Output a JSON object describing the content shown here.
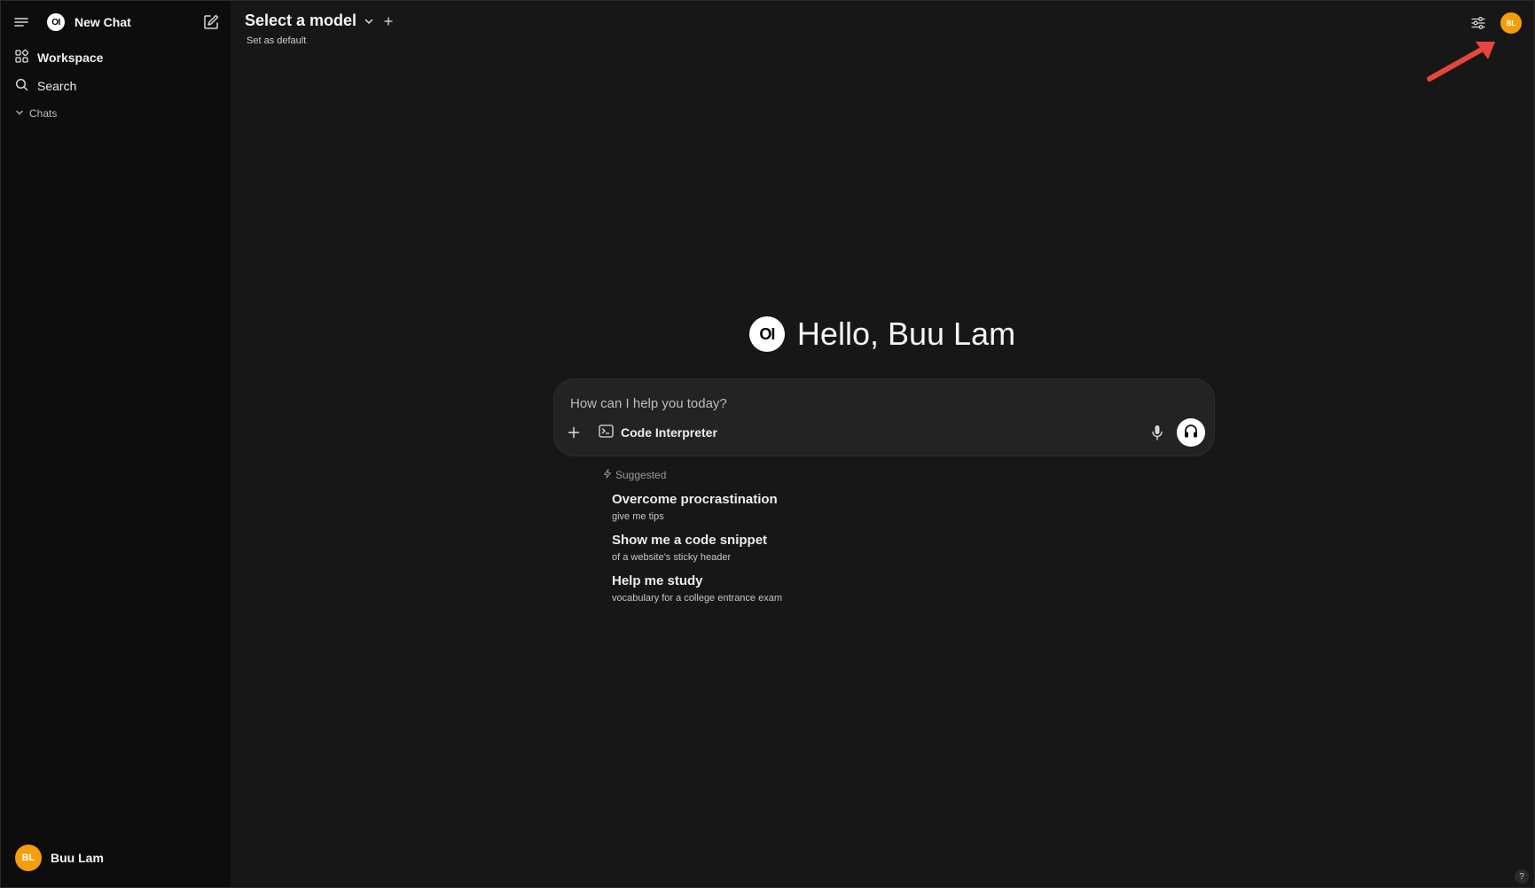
{
  "sidebar": {
    "logo_text": "OI",
    "new_chat_label": "New Chat",
    "items": [
      {
        "label": "Workspace",
        "icon": "workspace-icon"
      },
      {
        "label": "Search",
        "icon": "search-icon"
      }
    ],
    "chats_section_label": "Chats",
    "user": {
      "initials": "BL",
      "name": "Buu Lam"
    }
  },
  "header": {
    "model_title": "Select a model",
    "set_default_label": "Set as default",
    "avatar_initials": "BL"
  },
  "greeting": {
    "logo_text": "OI",
    "text": "Hello, Buu Lam"
  },
  "composer": {
    "placeholder": "How can I help you today?",
    "value": "",
    "code_interpreter_label": "Code Interpreter"
  },
  "suggested": {
    "heading": "Suggested",
    "items": [
      {
        "title": "Overcome procrastination",
        "subtitle": "give me tips"
      },
      {
        "title": "Show me a code snippet",
        "subtitle": "of a website's sticky header"
      },
      {
        "title": "Help me study",
        "subtitle": "vocabulary for a college entrance exam"
      }
    ]
  },
  "help_label": "?",
  "colors": {
    "sidebar_bg": "#0d0d0d",
    "main_bg": "#171717",
    "avatar": "#f59e0b",
    "annotation_arrow": "#e8453c"
  }
}
